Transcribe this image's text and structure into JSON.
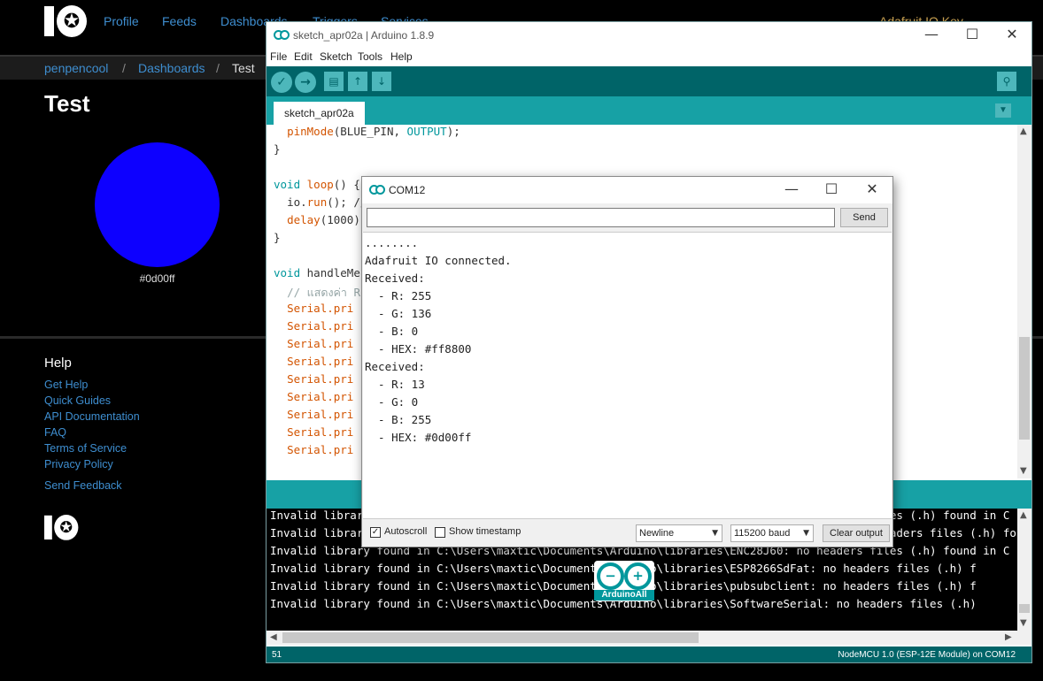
{
  "topnav": {
    "links": [
      "Profile",
      "Feeds",
      "Dashboards",
      "Triggers",
      "Services"
    ],
    "key_label": "Adafruit IO Key"
  },
  "breadcrumb": {
    "user": "penpencool",
    "section": "Dashboards",
    "current": "Test",
    "separator": "/"
  },
  "dashboard": {
    "title": "Test",
    "color_value": "#0d00ff"
  },
  "help": {
    "title": "Help",
    "links": [
      "Get Help",
      "Quick Guides",
      "API Documentation",
      "FAQ",
      "Terms of Service",
      "Privacy Policy"
    ],
    "feedback": "Send Feedback"
  },
  "ide": {
    "title": "sketch_apr02a | Arduino 1.8.9",
    "menu": [
      "File",
      "Edit",
      "Sketch",
      "Tools",
      "Help"
    ],
    "tab": "sketch_apr02a",
    "footer_line": "51",
    "footer_board": "NodeMCU 1.0 (ESP-12E Module) on COM12",
    "code": {
      "l1_fn": "pinMode",
      "l1_a": "(BLUE_PIN, ",
      "l1_kw": "OUTPUT",
      "l1_b": ");",
      "l2": "}",
      "l3_kw": "void",
      "l3_fn": "loop",
      "l3_rest": "() {",
      "l4_a": "io.",
      "l4_fn": "run",
      "l4_b": "(); //",
      "l5_fn": "delay",
      "l5_rest": "(1000);",
      "l6": "}",
      "l7_kw": "void",
      "l7_fn": "handleMe",
      "l8": "// แสดงค่า R",
      "serial_prefix": "Serial.pri"
    },
    "console": [
      "Invalid library found in C:\\Users\\maxtic\\Documents\\Arduino\\libraries\\ENC28J60: no headers files (.h) found in C",
      "Invalid library found in C:\\Users\\maxtic\\Documents\\Arduino\\libraries\\ESP8266HTTPClient: no headers files (.h) found in C",
      "Invalid library found in C:\\Users\\maxtic\\Documents\\Arduino\\libraries\\ENC28J60: no headers files (.h) found in C",
      "Invalid library found in C:\\Users\\maxtic\\Documents\\Arduino\\libraries\\ESP8266SdFat: no headers files (.h) f",
      "Invalid library found in C:\\Users\\maxtic\\Documents\\Arduino\\libraries\\pubsubclient: no headers files (.h) f",
      "Invalid library found in C:\\Users\\maxtic\\Documents\\Arduino\\libraries\\SoftwareSerial: no headers files (.h)"
    ]
  },
  "serial_monitor": {
    "title": "COM12",
    "input_value": "",
    "send_label": "Send",
    "output": [
      "........",
      "Adafruit IO connected.",
      "Received:",
      "  - R: 255",
      "  - G: 136",
      "  - B: 0",
      "  - HEX: #ff8800",
      "Received:",
      "  - R: 13",
      "  - G: 0",
      "  - B: 255",
      "  - HEX: #0d00ff"
    ],
    "autoscroll_label": "Autoscroll",
    "autoscroll_checked": "✓",
    "timestamp_label": "Show timestamp",
    "line_ending": "Newline",
    "baud": "115200 baud",
    "clear_label": "Clear output"
  },
  "watermark": {
    "minus": "−",
    "plus": "+",
    "text": "ArduinoAll"
  },
  "colors": {
    "arduino_teal": "#00979c",
    "arduino_dark": "#006468",
    "swatch": "#0d00ff",
    "adafruit_link": "#3e8ed0"
  }
}
